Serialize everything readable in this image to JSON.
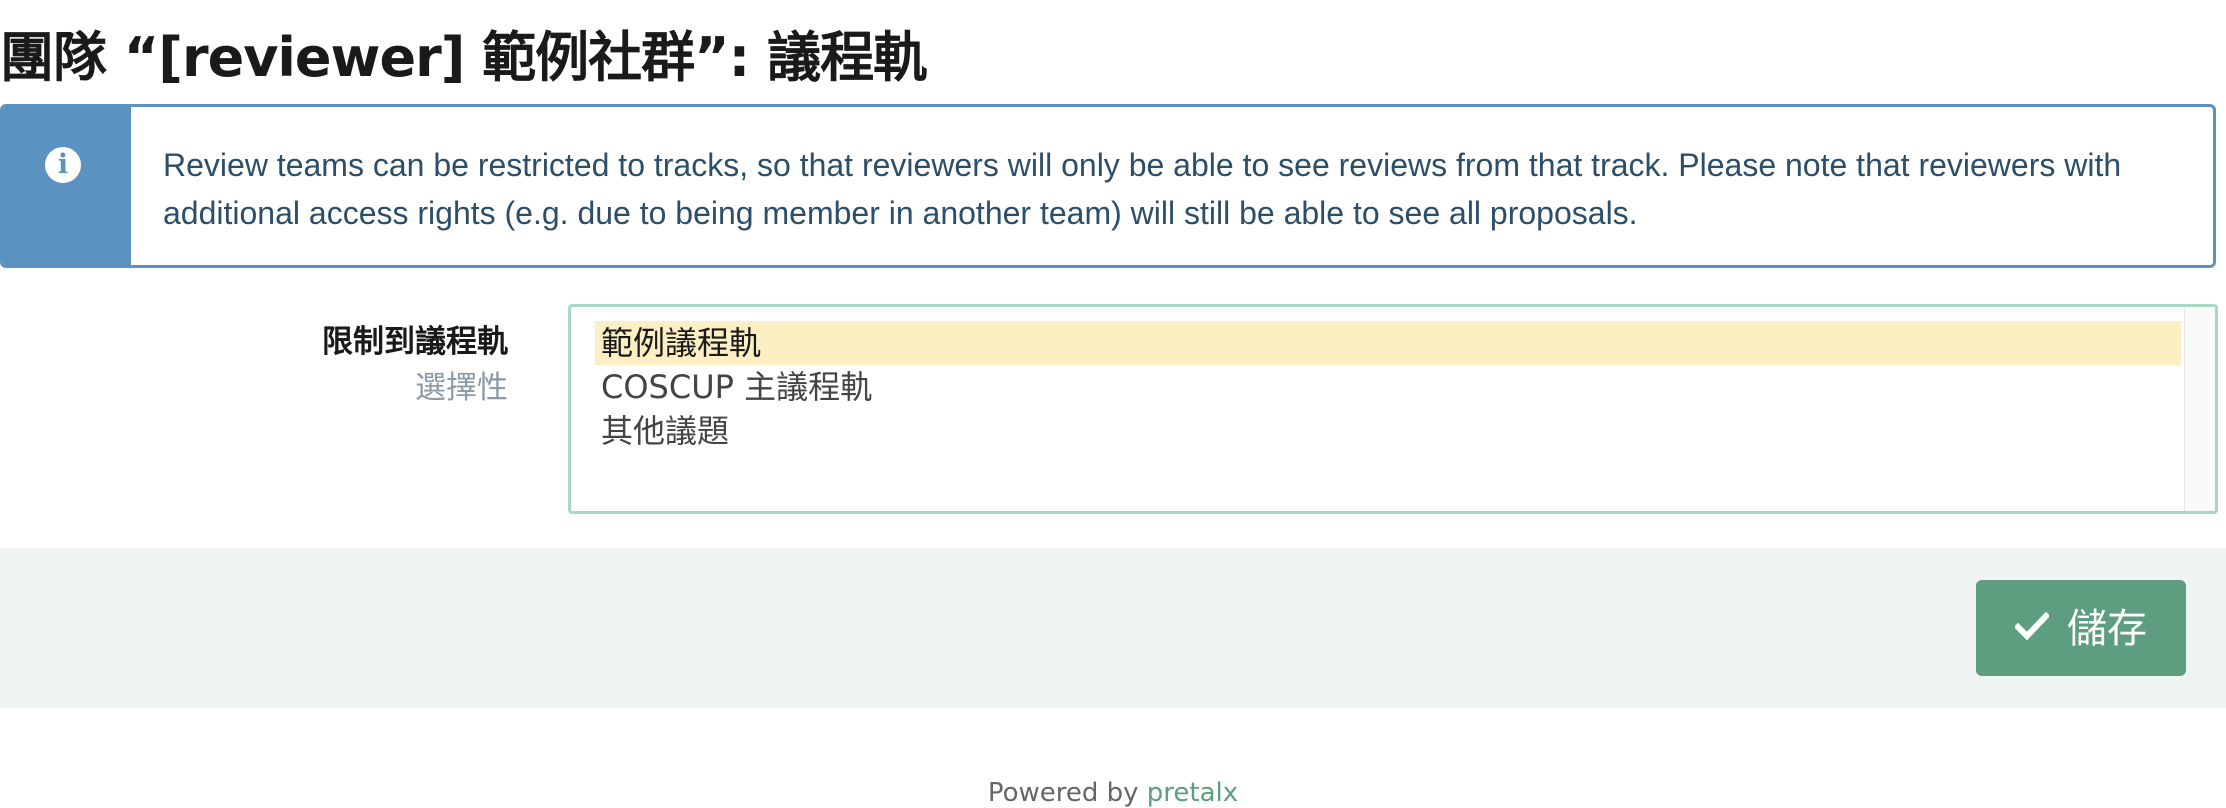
{
  "page": {
    "title": "團隊 “[reviewer] 範例社群”: 議程軌"
  },
  "info": {
    "icon": "info-circle-icon",
    "text": "Review teams can be restricted to tracks, so that reviewers will only be able to see reviews from that track. Please note that reviewers with additional access rights (e.g. due to being member in another team) will still be able to see all proposals."
  },
  "form": {
    "tracks_label": "限制到議程軌",
    "tracks_optional": "選擇性",
    "tracks_options": [
      {
        "label": "範例議程軌",
        "selected": true
      },
      {
        "label": "COSCUP 主議程軌",
        "selected": false
      },
      {
        "label": "其他議題",
        "selected": false
      }
    ]
  },
  "actions": {
    "save_label": "儲存",
    "save_icon": "check-icon",
    "save_color": "#5c9e7f"
  },
  "footer": {
    "prefix": "Powered by ",
    "link_text": "pretalx"
  },
  "colors": {
    "info_accent": "#5b93c0",
    "selected_option_bg": "#fcefc3",
    "select_border": "#a6d9c4"
  }
}
